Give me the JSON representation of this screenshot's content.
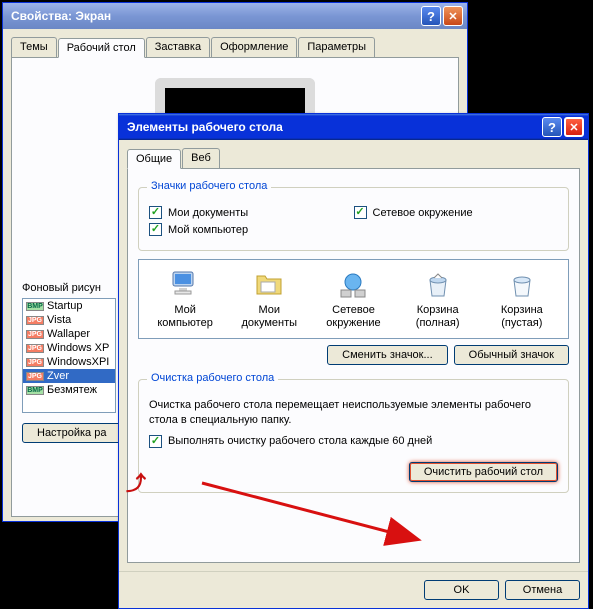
{
  "parent_window": {
    "title": "Свойства: Экран",
    "tabs": [
      "Темы",
      "Рабочий стол",
      "Заставка",
      "Оформление",
      "Параметры"
    ],
    "active_tab": 1,
    "bg_label": "Фоновый рисун",
    "bg_items": [
      {
        "type": "bmp",
        "name": "Startup"
      },
      {
        "type": "jpg",
        "name": "Vista"
      },
      {
        "type": "jpg",
        "name": "Wallaper"
      },
      {
        "type": "jpg",
        "name": "Windows XP"
      },
      {
        "type": "jpg",
        "name": "WindowsXPI"
      },
      {
        "type": "jpg",
        "name": "Zver",
        "selected": true
      },
      {
        "type": "bmp",
        "name": "Безмятеж"
      }
    ],
    "customize_btn": "Настройка ра"
  },
  "child_window": {
    "title": "Элементы рабочего стола",
    "tabs": [
      "Общие",
      "Веб"
    ],
    "active_tab": 0,
    "group_icons_title": "Значки рабочего стола",
    "checkboxes": {
      "my_docs": "Мои документы",
      "network": "Сетевое окружение",
      "my_computer": "Мой компьютер"
    },
    "icon_items": [
      "Мой компьютер",
      "Мои документы",
      "Сетевое окружение",
      "Корзина (полная)",
      "Корзина (пустая)"
    ],
    "change_icon_btn": "Сменить значок...",
    "default_icon_btn": "Обычный значок",
    "group_cleanup_title": "Очистка рабочего стола",
    "cleanup_desc": "Очистка рабочего стола перемещает неиспользуемые элементы рабочего стола в специальную папку.",
    "cleanup_checkbox": "Выполнять очистку рабочего стола каждые 60 дней",
    "cleanup_btn": "Очистить рабочий стол",
    "ok_btn": "OK",
    "cancel_btn": "Отмена"
  }
}
